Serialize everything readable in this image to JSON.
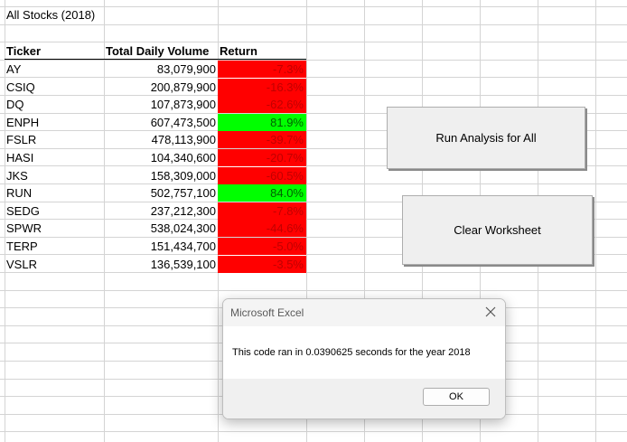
{
  "sheet": {
    "title_cell": "All Stocks (2018)",
    "headers": {
      "ticker": "Ticker",
      "volume": "Total Daily Volume",
      "return": "Return"
    },
    "rows": [
      {
        "ticker": "AY",
        "volume": "83,079,900",
        "return": "-7.3%",
        "status": "negative"
      },
      {
        "ticker": "CSIQ",
        "volume": "200,879,900",
        "return": "-16.3%",
        "status": "negative"
      },
      {
        "ticker": "DQ",
        "volume": "107,873,900",
        "return": "-62.6%",
        "status": "negative"
      },
      {
        "ticker": "ENPH",
        "volume": "607,473,500",
        "return": "81.9%",
        "status": "positive"
      },
      {
        "ticker": "FSLR",
        "volume": "478,113,900",
        "return": "-39.7%",
        "status": "negative"
      },
      {
        "ticker": "HASI",
        "volume": "104,340,600",
        "return": "-20.7%",
        "status": "negative"
      },
      {
        "ticker": "JKS",
        "volume": "158,309,000",
        "return": "-60.5%",
        "status": "negative"
      },
      {
        "ticker": "RUN",
        "volume": "502,757,100",
        "return": "84.0%",
        "status": "positive"
      },
      {
        "ticker": "SEDG",
        "volume": "237,212,300",
        "return": "-7.8%",
        "status": "negative"
      },
      {
        "ticker": "SPWR",
        "volume": "538,024,300",
        "return": "-44.6%",
        "status": "negative"
      },
      {
        "ticker": "TERP",
        "volume": "151,434,700",
        "return": "-5.0%",
        "status": "negative"
      },
      {
        "ticker": "VSLR",
        "volume": "136,539,100",
        "return": "-3.5%",
        "status": "negative"
      }
    ]
  },
  "buttons": {
    "run_all": "Run Analysis for All",
    "clear": "Clear Worksheet"
  },
  "dialog": {
    "title": "Microsoft Excel",
    "message": "This code ran in 0.0390625 seconds for the year 2018",
    "ok_label": "OK"
  },
  "colors": {
    "negative_fill": "#ff0000",
    "positive_fill": "#00ff00",
    "gridline": "#d4d4d4"
  },
  "icons": {
    "dialog_close": "close-icon"
  }
}
